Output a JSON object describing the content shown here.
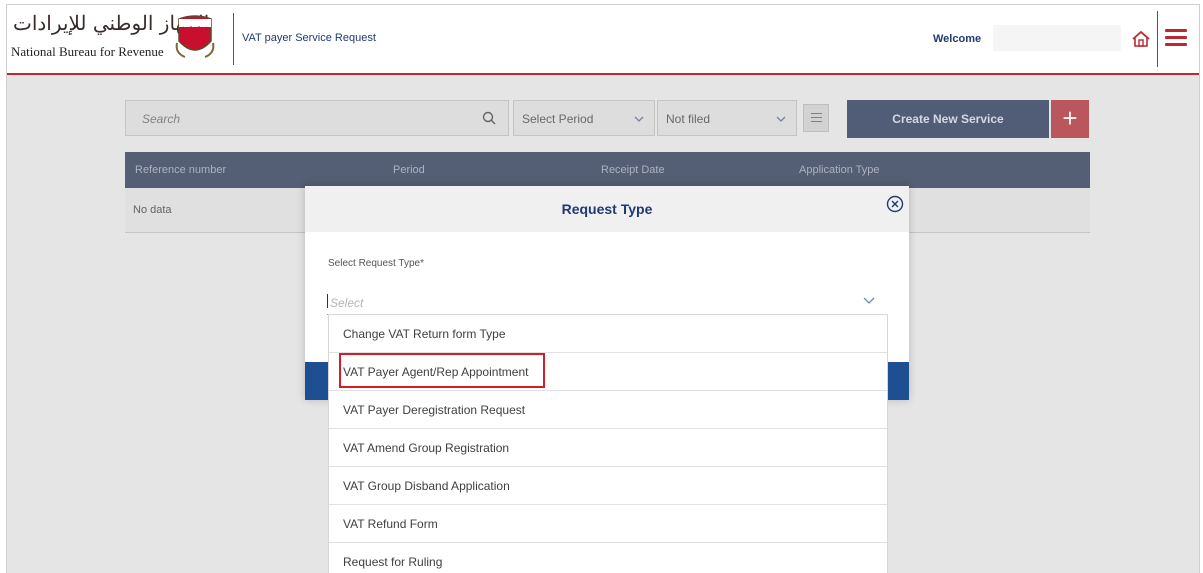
{
  "header": {
    "logo_arabic": "الجهاز الوطني للإيرادات",
    "logo_english": "National Bureau for Revenue",
    "page_title": "VAT payer Service Request",
    "welcome": "Welcome",
    "user_name": "",
    "home_icon": "home-icon",
    "menu_icon": "hamburger-menu-icon",
    "brand_color": "#b9292f"
  },
  "toolbar": {
    "search_placeholder": "Search",
    "period_select": "Select Period",
    "status_select": "Not filed",
    "create_button": "Create New Service",
    "add_button": "+"
  },
  "table": {
    "columns": [
      "Reference number",
      "Period",
      "Receipt Date",
      "Application Type"
    ],
    "empty_text": "No data"
  },
  "modal": {
    "title": "Request Type",
    "field_label": "Select Request Type*",
    "placeholder": "Select",
    "options": [
      "Change VAT Return form Type",
      "VAT Payer Agent/Rep Appointment",
      "VAT Payer Deregistration Request",
      "VAT Amend Group Registration",
      "VAT Group Disband Application",
      "VAT Refund Form",
      "Request for Ruling"
    ],
    "highlighted_option": "VAT Payer Agent/Rep Appointment"
  }
}
